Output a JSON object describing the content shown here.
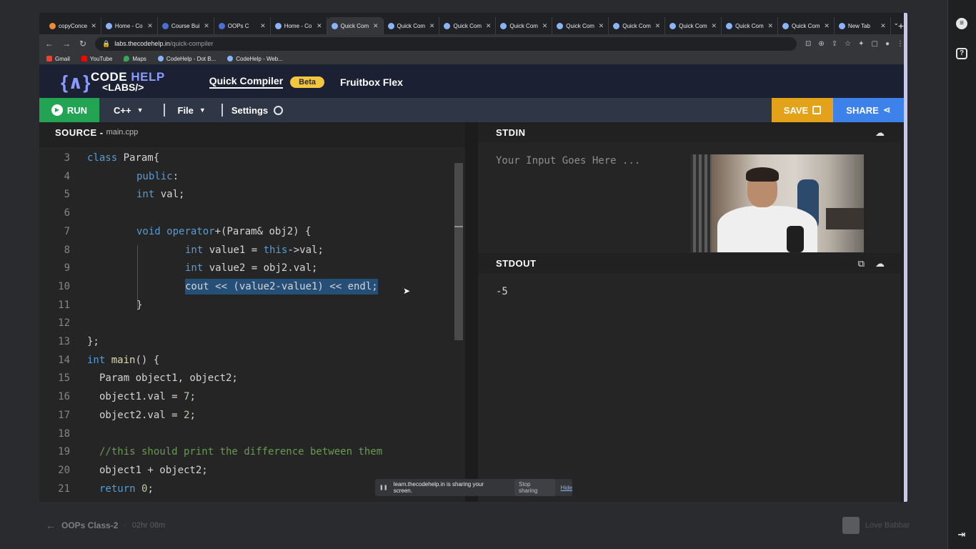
{
  "browser": {
    "tabs": [
      {
        "label": "copyConce",
        "fav": "orange"
      },
      {
        "label": "Home - Co",
        "fav": "ch"
      },
      {
        "label": "Course Bui",
        "fav": "blue"
      },
      {
        "label": "OOPs C",
        "fav": "blue"
      },
      {
        "label": "Home - Co",
        "fav": "ch"
      },
      {
        "label": "Quick Com",
        "fav": "ch",
        "active": true
      },
      {
        "label": "Quick Com",
        "fav": "ch"
      },
      {
        "label": "Quick Com",
        "fav": "ch"
      },
      {
        "label": "Quick Com",
        "fav": "ch"
      },
      {
        "label": "Quick Com",
        "fav": "ch"
      },
      {
        "label": "Quick Com",
        "fav": "ch"
      },
      {
        "label": "Quick Com",
        "fav": "ch"
      },
      {
        "label": "Quick Com",
        "fav": "ch"
      },
      {
        "label": "Quick Com",
        "fav": "ch"
      },
      {
        "label": "New Tab",
        "fav": "chrome"
      }
    ],
    "url_domain": "labs.thecodehelp.in",
    "url_path": "/quick-compiler",
    "bookmarks": [
      {
        "label": "Gmail",
        "icon": "gmail"
      },
      {
        "label": "YouTube",
        "icon": "yt"
      },
      {
        "label": "Maps",
        "icon": "maps"
      },
      {
        "label": "CodeHelp - Dot B...",
        "icon": "ch"
      },
      {
        "label": "CodeHelp - Web...",
        "icon": "ch"
      }
    ]
  },
  "app": {
    "logo_line1_a": "CODE ",
    "logo_line1_b": "HELP",
    "logo_line2": "<LABS/>",
    "nav_active": "Quick Compiler",
    "beta": "Beta",
    "nav_second": "Fruitbox Flex",
    "run_label": "RUN",
    "lang": "C++",
    "file_menu": "File",
    "settings": "Settings",
    "save_label": "SAVE",
    "share_label": "SHARE",
    "colors": {
      "run": "#23a455",
      "save": "#e3a21a",
      "share": "#3d82ea",
      "beta": "#f3c640"
    }
  },
  "source": {
    "title": "SOURCE -",
    "filename": "main.cpp"
  },
  "code_lines": [
    {
      "n": "3",
      "indent": 0,
      "text": "class Param{"
    },
    {
      "n": "4",
      "indent": 1,
      "text": "public:"
    },
    {
      "n": "5",
      "indent": 1,
      "text": "int val;"
    },
    {
      "n": "6",
      "indent": 0,
      "text": ""
    },
    {
      "n": "7",
      "indent": 1,
      "text": "void operator+(Param& obj2) {"
    },
    {
      "n": "8",
      "indent": 2,
      "text": "int value1 = this->val;"
    },
    {
      "n": "9",
      "indent": 2,
      "text": "int value2 = obj2.val;"
    },
    {
      "n": "10",
      "indent": 2,
      "text": "cout << (value2-value1) << endl;",
      "selected": true
    },
    {
      "n": "11",
      "indent": 1,
      "text": "}"
    },
    {
      "n": "12",
      "indent": 0,
      "text": ""
    },
    {
      "n": "13",
      "indent": 0,
      "text": "};"
    },
    {
      "n": "14",
      "indent": 0,
      "text": "int main() {"
    },
    {
      "n": "15",
      "indent": 3,
      "text": "Param object1, object2;"
    },
    {
      "n": "16",
      "indent": 3,
      "text": "object1.val = 7;"
    },
    {
      "n": "17",
      "indent": 3,
      "text": "object2.val = 2;"
    },
    {
      "n": "18",
      "indent": 0,
      "text": ""
    },
    {
      "n": "19",
      "indent": 3,
      "text": "//this should print the difference between them"
    },
    {
      "n": "20",
      "indent": 3,
      "text": "object1 + object2;"
    },
    {
      "n": "21",
      "indent": 3,
      "text": "return 0;"
    }
  ],
  "stdin": {
    "title": "STDIN",
    "placeholder": "Your Input Goes Here ..."
  },
  "stdout": {
    "title": "STDOUT",
    "output": "-5"
  },
  "share_banner": {
    "message": "learn.thecodehelp.in is sharing your screen.",
    "stop": "Stop sharing",
    "hide": "Hide"
  },
  "player": {
    "course_title": "OOPs Class-2",
    "separator": "·",
    "duration": "02hr 08m",
    "author": "Love Babbar"
  }
}
